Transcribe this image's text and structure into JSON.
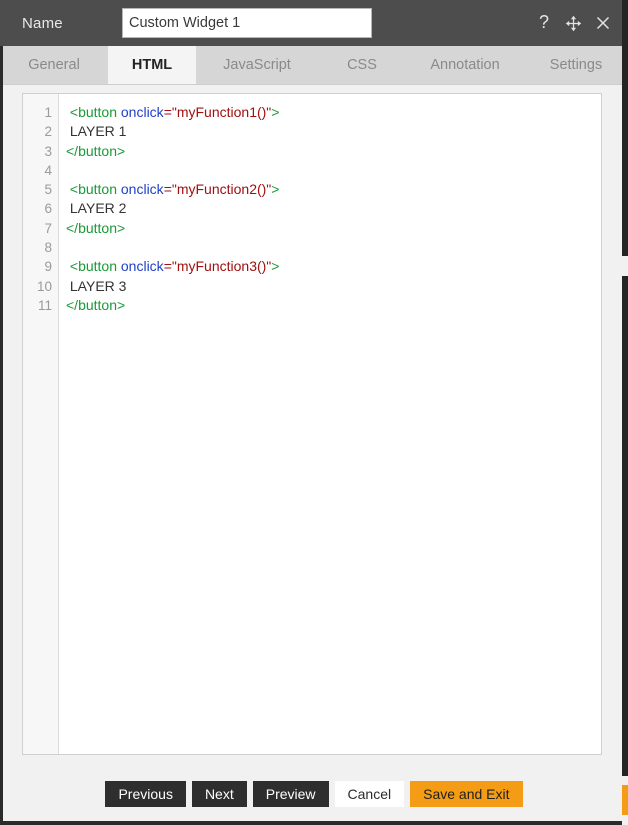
{
  "titlebar": {
    "name_label": "Name",
    "name_value": "Custom Widget 1",
    "name_placeholder": "Name",
    "controls": [
      {
        "name": "help-icon",
        "glyph": "?"
      },
      {
        "name": "move-icon",
        "glyph": "✥"
      },
      {
        "name": "close-icon",
        "glyph": "✕"
      }
    ]
  },
  "tabs": [
    {
      "label": "General",
      "active": false
    },
    {
      "label": "HTML",
      "active": true
    },
    {
      "label": "JavaScript",
      "active": false
    },
    {
      "label": "CSS",
      "active": false
    },
    {
      "label": "Annotation",
      "active": false
    },
    {
      "label": "Settings",
      "active": false
    }
  ],
  "editor": {
    "language": "HTML",
    "line_numbers": [
      "1",
      "2",
      "3",
      "4",
      "5",
      "6",
      "7",
      "8",
      "9",
      "10",
      "11"
    ],
    "lines": [
      " <button onclick=\"myFunction1()\">",
      " LAYER 1",
      "</button>",
      "",
      " <button onclick=\"myFunction2()\">",
      " LAYER 2",
      "</button>",
      "",
      " <button onclick=\"myFunction3()\">",
      " LAYER 3",
      "</button>"
    ],
    "tokens": [
      [
        {
          "t": " ",
          "c": "text"
        },
        {
          "t": "<button",
          "c": "tag"
        },
        {
          "t": " ",
          "c": "text"
        },
        {
          "t": "onclick",
          "c": "attr"
        },
        {
          "t": "=\"myFunction1()\"",
          "c": "str"
        },
        {
          "t": ">",
          "c": "tag"
        }
      ],
      [
        {
          "t": " LAYER 1",
          "c": "text"
        }
      ],
      [
        {
          "t": "</button>",
          "c": "tag"
        }
      ],
      [
        {
          "t": "",
          "c": "text"
        }
      ],
      [
        {
          "t": " ",
          "c": "text"
        },
        {
          "t": "<button",
          "c": "tag"
        },
        {
          "t": " ",
          "c": "text"
        },
        {
          "t": "onclick",
          "c": "attr"
        },
        {
          "t": "=\"myFunction2()\"",
          "c": "str"
        },
        {
          "t": ">",
          "c": "tag"
        }
      ],
      [
        {
          "t": " LAYER 2",
          "c": "text"
        }
      ],
      [
        {
          "t": "</button>",
          "c": "tag"
        }
      ],
      [
        {
          "t": "",
          "c": "text"
        }
      ],
      [
        {
          "t": " ",
          "c": "text"
        },
        {
          "t": "<button",
          "c": "tag"
        },
        {
          "t": " ",
          "c": "text"
        },
        {
          "t": "onclick",
          "c": "attr"
        },
        {
          "t": "=\"myFunction3()\"",
          "c": "str"
        },
        {
          "t": ">",
          "c": "tag"
        }
      ],
      [
        {
          "t": " LAYER 3",
          "c": "text"
        }
      ],
      [
        {
          "t": "</button>",
          "c": "tag"
        }
      ]
    ]
  },
  "footer": {
    "buttons": [
      {
        "label": "Previous",
        "style": "dark"
      },
      {
        "label": "Next",
        "style": "dark"
      },
      {
        "label": "Preview",
        "style": "dark"
      },
      {
        "label": "Cancel",
        "style": "light"
      },
      {
        "label": "Save and Exit",
        "style": "accent"
      }
    ]
  },
  "colors": {
    "titlebar_bg": "#4d4d4d",
    "tabbar_bg": "#d6d6d6",
    "active_tab_bg": "#f4f4f4",
    "page_bg": "#f1f1f1",
    "accent": "#f59c16",
    "button_dark": "#2e2e2e",
    "code_tag": "#1a9a37",
    "code_attr": "#2040c8",
    "code_string": "#a01010",
    "code_text": "#333333",
    "gutter_text": "#9a9a9a"
  }
}
